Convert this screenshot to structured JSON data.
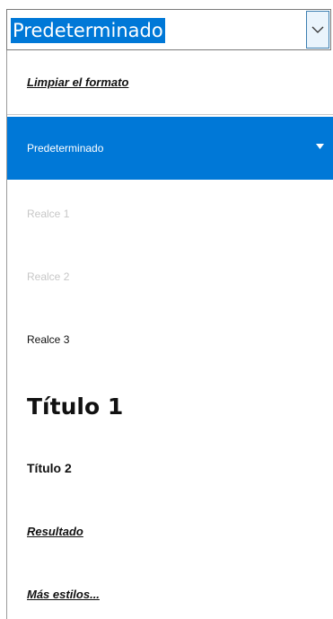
{
  "combo": {
    "value": "Predeterminado",
    "dropdown_icon": "chevron-down-icon"
  },
  "list": {
    "clear_format": "Limpiar el formato",
    "selected_item": "Predeterminado",
    "items": [
      {
        "label": "Realce 1",
        "state": "disabled"
      },
      {
        "label": "Realce 2",
        "state": "disabled"
      },
      {
        "label": "Realce 3",
        "state": "normal"
      },
      {
        "label": "Título 1",
        "state": "normal"
      },
      {
        "label": "Título 2",
        "state": "normal"
      }
    ],
    "result": "Resultado",
    "more_styles": "Más estilos..."
  },
  "colors": {
    "selection": "#0078d7",
    "disabled_text": "#c7c7c7"
  }
}
